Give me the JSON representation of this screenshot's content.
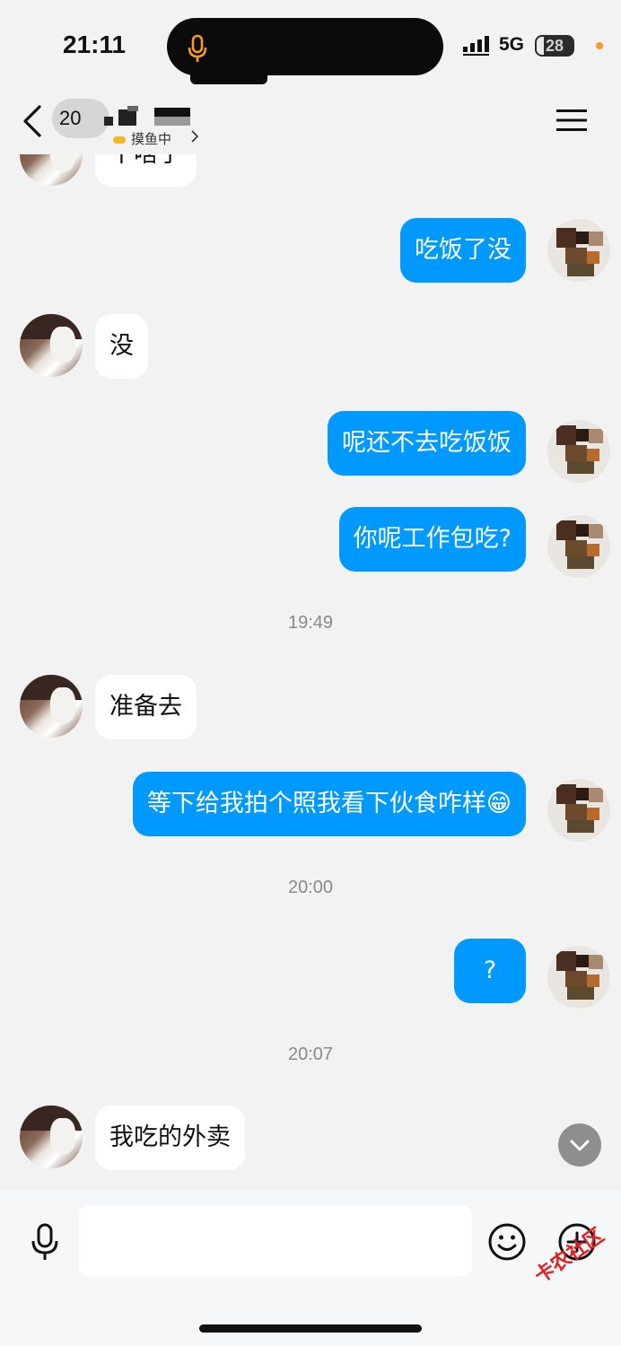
{
  "status_bar": {
    "time": "21:11",
    "network": "5G",
    "battery": "28",
    "mic_icon": "microphone-icon",
    "accent": "#f59a23"
  },
  "header": {
    "title_prefix": "20",
    "subtitle": "摸鱼中",
    "back_icon": "chevron-left-icon",
    "menu_icon": "hamburger-menu-icon"
  },
  "chat": {
    "messages": [
      {
        "side": "in",
        "text": "干啥子"
      },
      {
        "side": "out",
        "text": "吃饭了没"
      },
      {
        "side": "in",
        "text": "没"
      },
      {
        "side": "out",
        "text": "呢还不去吃饭饭"
      },
      {
        "side": "out",
        "text": "你呢工作包吃?"
      },
      {
        "type": "time",
        "text": "19:49"
      },
      {
        "side": "in",
        "text": "准备去"
      },
      {
        "side": "out",
        "text": "等下给我拍个照我看下伙食咋样😁"
      },
      {
        "type": "time",
        "text": "20:00"
      },
      {
        "side": "out",
        "text": "?"
      },
      {
        "type": "time",
        "text": "20:07"
      },
      {
        "side": "in",
        "text": "我吃的外卖"
      }
    ]
  },
  "input_bar": {
    "voice_icon": "microphone-icon",
    "emoji_icon": "smiley-icon",
    "plus_icon": "plus-circle-icon",
    "scroll_icon": "chevron-down-icon"
  },
  "watermark": "卡农社区",
  "colors": {
    "outgoing_bubble": "#0099ff",
    "incoming_bubble": "#ffffff",
    "background": "#f2f2f2"
  }
}
